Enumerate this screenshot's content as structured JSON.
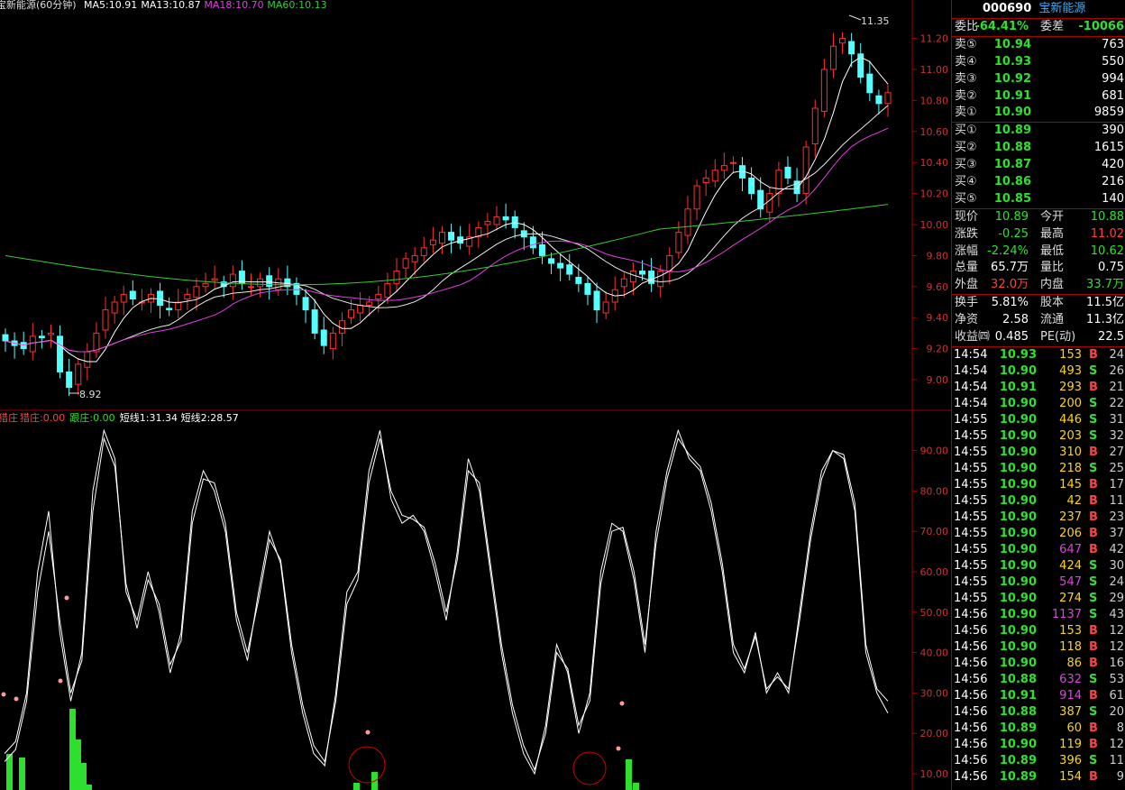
{
  "main_chart": {
    "title": "宝新能源(60分钟)",
    "ma": [
      {
        "label": "MA5:10.91",
        "color": "#ffffff"
      },
      {
        "label": "MA13:10.87",
        "color": "#ffffff"
      },
      {
        "label": "MA18:10.70",
        "color": "#e040e0"
      },
      {
        "label": "MA60:10.13",
        "color": "#33cc33"
      }
    ],
    "y_ticks": [
      "11.20",
      "11.00",
      "10.80",
      "10.60",
      "10.40",
      "10.20",
      "10.00",
      "9.80",
      "9.60",
      "9.40",
      "9.20",
      "9.00"
    ],
    "high_label": "11.35",
    "low_label": "8.92"
  },
  "sub_chart": {
    "title": "猎庄",
    "items": [
      {
        "label": "猎庄:0.00",
        "color": "#ff4040"
      },
      {
        "label": "跟庄:0.00",
        "color": "#2ee02e"
      },
      {
        "label": "短线1:31.34",
        "color": "#ffffff"
      },
      {
        "label": "短线2:28.57",
        "color": "#ffffff"
      }
    ],
    "y_ticks": [
      "90.00",
      "80.00",
      "70.00",
      "60.00",
      "50.00",
      "40.00",
      "30.00",
      "20.00",
      "10.00"
    ]
  },
  "chart_data": {
    "type": "line",
    "price_series": {
      "name": "宝新能源",
      "y_range": [
        8.9,
        11.4
      ],
      "closes": [
        9.25,
        9.22,
        9.2,
        9.28,
        9.27,
        9.3,
        9.05,
        8.95,
        9.1,
        9.18,
        9.3,
        9.45,
        9.5,
        9.55,
        9.52,
        9.5,
        9.55,
        9.48,
        9.45,
        9.5,
        9.55,
        9.6,
        9.62,
        9.65,
        9.6,
        9.68,
        9.62,
        9.6,
        9.65,
        9.6,
        9.65,
        9.6,
        9.55,
        9.45,
        9.3,
        9.22,
        9.3,
        9.38,
        9.45,
        9.48,
        9.5,
        9.55,
        9.62,
        9.7,
        9.78,
        9.8,
        9.85,
        9.9,
        9.95,
        9.9,
        9.88,
        9.92,
        9.98,
        10.02,
        10.05,
        10.03,
        9.98,
        9.92,
        9.85,
        9.8,
        9.75,
        9.72,
        9.68,
        9.62,
        9.55,
        9.45,
        9.5,
        9.58,
        9.65,
        9.7,
        9.68,
        9.62,
        9.7,
        9.8,
        9.95,
        10.1,
        10.25,
        10.3,
        10.35,
        10.38,
        10.4,
        10.3,
        10.2,
        10.1,
        10.2,
        10.35,
        10.3,
        10.2,
        10.5,
        10.75,
        11.0,
        11.15,
        11.2,
        11.1,
        10.95,
        10.85,
        10.78,
        10.85
      ],
      "ma60_start": 9.8,
      "ma60_end": 10.13
    },
    "indicator_series": [
      {
        "name": "短线1",
        "values": [
          15,
          18,
          30,
          60,
          75,
          45,
          28,
          40,
          80,
          95,
          88,
          55,
          48,
          60,
          50,
          35,
          45,
          75,
          85,
          80,
          70,
          48,
          38,
          55,
          70,
          62,
          40,
          25,
          15,
          12,
          30,
          55,
          60,
          85,
          95,
          78,
          72,
          74,
          70,
          60,
          48,
          65,
          88,
          80,
          60,
          40,
          25,
          15,
          10,
          22,
          42,
          35,
          20,
          30,
          60,
          72,
          70,
          58,
          40,
          70,
          85,
          95,
          88,
          85,
          75,
          60,
          40,
          35,
          45,
          30,
          35,
          30,
          50,
          70,
          85,
          90,
          88,
          75,
          40,
          30,
          25
        ]
      },
      {
        "name": "短线2",
        "values": [
          13,
          16,
          28,
          55,
          70,
          48,
          30,
          38,
          75,
          93,
          86,
          57,
          46,
          58,
          52,
          37,
          43,
          72,
          83,
          82,
          72,
          50,
          40,
          53,
          68,
          63,
          42,
          27,
          17,
          13,
          28,
          52,
          58,
          82,
          93,
          80,
          74,
          73,
          71,
          62,
          50,
          63,
          85,
          82,
          62,
          42,
          27,
          17,
          11,
          20,
          40,
          36,
          22,
          28,
          57,
          70,
          71,
          60,
          42,
          67,
          83,
          93,
          89,
          86,
          77,
          62,
          42,
          36,
          44,
          31,
          34,
          31,
          48,
          68,
          83,
          90,
          89,
          77,
          42,
          31,
          28
        ]
      }
    ],
    "bar_series": {
      "name": "跟庄",
      "color": "#2ee02e"
    }
  },
  "panel": {
    "code": "000690",
    "name": "宝新能源",
    "weibi": {
      "label": "委比",
      "value": "-64.41%",
      "label2": "委差",
      "value2": "-10066"
    },
    "sells": [
      {
        "label": "卖⑤",
        "price": "10.94",
        "vol": "763"
      },
      {
        "label": "卖④",
        "price": "10.93",
        "vol": "550"
      },
      {
        "label": "卖③",
        "price": "10.92",
        "vol": "994"
      },
      {
        "label": "卖②",
        "price": "10.91",
        "vol": "681"
      },
      {
        "label": "卖①",
        "price": "10.90",
        "vol": "9859"
      }
    ],
    "buys": [
      {
        "label": "买①",
        "price": "10.89",
        "vol": "390"
      },
      {
        "label": "买②",
        "price": "10.88",
        "vol": "1615"
      },
      {
        "label": "买③",
        "price": "10.87",
        "vol": "420"
      },
      {
        "label": "买④",
        "price": "10.86",
        "vol": "216"
      },
      {
        "label": "买⑤",
        "price": "10.85",
        "vol": "140"
      }
    ],
    "stats1": [
      {
        "l1": "现价",
        "v1": "10.89",
        "c1": "green",
        "l2": "今开",
        "v2": "10.88",
        "c2": "green"
      },
      {
        "l1": "涨跌",
        "v1": "-0.25",
        "c1": "green",
        "l2": "最高",
        "v2": "11.02",
        "c2": "red"
      },
      {
        "l1": "涨幅",
        "v1": "-2.24%",
        "c1": "green",
        "l2": "最低",
        "v2": "10.62",
        "c2": "green"
      },
      {
        "l1": "总量",
        "v1": "65.7万",
        "c1": "white",
        "l2": "量比",
        "v2": "0.75",
        "c2": "white"
      },
      {
        "l1": "外盘",
        "v1": "32.0万",
        "c1": "red",
        "l2": "内盘",
        "v2": "33.7万",
        "c2": "green"
      }
    ],
    "stats2": [
      {
        "l1": "换手",
        "v1": "5.81%",
        "l2": "股本",
        "v2": "11.5亿"
      },
      {
        "l1": "净资",
        "v1": "2.58",
        "l2": "流通",
        "v2": "11.3亿"
      },
      {
        "l1": "收益㈣",
        "v1": "0.485",
        "l2": "PE(动)",
        "v2": "22.5"
      }
    ],
    "ticks": [
      {
        "t": "14:54",
        "p": "10.93",
        "pc": "green",
        "v": "153",
        "vc": "yellow",
        "s": "B",
        "sc": "red",
        "n": "24"
      },
      {
        "t": "14:54",
        "p": "10.90",
        "pc": "green",
        "v": "493",
        "vc": "yellow",
        "s": "S",
        "sc": "green",
        "n": "26"
      },
      {
        "t": "14:54",
        "p": "10.91",
        "pc": "green",
        "v": "293",
        "vc": "yellow",
        "s": "B",
        "sc": "red",
        "n": "21"
      },
      {
        "t": "14:54",
        "p": "10.90",
        "pc": "green",
        "v": "200",
        "vc": "yellow",
        "s": "S",
        "sc": "green",
        "n": "22"
      },
      {
        "t": "14:55",
        "p": "10.90",
        "pc": "green",
        "v": "446",
        "vc": "yellow",
        "s": "S",
        "sc": "green",
        "n": "31"
      },
      {
        "t": "14:55",
        "p": "10.90",
        "pc": "green",
        "v": "203",
        "vc": "yellow",
        "s": "S",
        "sc": "green",
        "n": "32"
      },
      {
        "t": "14:55",
        "p": "10.90",
        "pc": "green",
        "v": "310",
        "vc": "yellow",
        "s": "B",
        "sc": "red",
        "n": "27"
      },
      {
        "t": "14:55",
        "p": "10.90",
        "pc": "green",
        "v": "218",
        "vc": "yellow",
        "s": "S",
        "sc": "green",
        "n": "25"
      },
      {
        "t": "14:55",
        "p": "10.90",
        "pc": "green",
        "v": "145",
        "vc": "yellow",
        "s": "B",
        "sc": "red",
        "n": "17"
      },
      {
        "t": "14:55",
        "p": "10.90",
        "pc": "green",
        "v": "42",
        "vc": "yellow",
        "s": "B",
        "sc": "red",
        "n": "11"
      },
      {
        "t": "14:55",
        "p": "10.90",
        "pc": "green",
        "v": "237",
        "vc": "yellow",
        "s": "B",
        "sc": "red",
        "n": "23"
      },
      {
        "t": "14:55",
        "p": "10.90",
        "pc": "green",
        "v": "206",
        "vc": "yellow",
        "s": "B",
        "sc": "red",
        "n": "37"
      },
      {
        "t": "14:55",
        "p": "10.90",
        "pc": "green",
        "v": "647",
        "vc": "magenta",
        "s": "B",
        "sc": "red",
        "n": "42"
      },
      {
        "t": "14:55",
        "p": "10.90",
        "pc": "green",
        "v": "424",
        "vc": "yellow",
        "s": "S",
        "sc": "green",
        "n": "30"
      },
      {
        "t": "14:55",
        "p": "10.90",
        "pc": "green",
        "v": "547",
        "vc": "magenta",
        "s": "S",
        "sc": "green",
        "n": "24"
      },
      {
        "t": "14:55",
        "p": "10.90",
        "pc": "green",
        "v": "274",
        "vc": "yellow",
        "s": "S",
        "sc": "green",
        "n": "29"
      },
      {
        "t": "14:56",
        "p": "10.90",
        "pc": "green",
        "v": "1137",
        "vc": "magenta",
        "s": "S",
        "sc": "green",
        "n": "43"
      },
      {
        "t": "14:56",
        "p": "10.90",
        "pc": "green",
        "v": "153",
        "vc": "yellow",
        "s": "B",
        "sc": "red",
        "n": "12"
      },
      {
        "t": "14:56",
        "p": "10.90",
        "pc": "green",
        "v": "118",
        "vc": "yellow",
        "s": "B",
        "sc": "red",
        "n": "12"
      },
      {
        "t": "14:56",
        "p": "10.90",
        "pc": "green",
        "v": "86",
        "vc": "yellow",
        "s": "B",
        "sc": "red",
        "n": "16"
      },
      {
        "t": "14:56",
        "p": "10.88",
        "pc": "green",
        "v": "632",
        "vc": "magenta",
        "s": "S",
        "sc": "green",
        "n": "53"
      },
      {
        "t": "14:56",
        "p": "10.91",
        "pc": "green",
        "v": "914",
        "vc": "magenta",
        "s": "B",
        "sc": "red",
        "n": "61"
      },
      {
        "t": "14:56",
        "p": "10.88",
        "pc": "green",
        "v": "387",
        "vc": "yellow",
        "s": "S",
        "sc": "green",
        "n": "20"
      },
      {
        "t": "14:56",
        "p": "10.89",
        "pc": "green",
        "v": "60",
        "vc": "yellow",
        "s": "B",
        "sc": "red",
        "n": "8"
      },
      {
        "t": "14:56",
        "p": "10.90",
        "pc": "green",
        "v": "119",
        "vc": "yellow",
        "s": "B",
        "sc": "red",
        "n": "12"
      },
      {
        "t": "14:56",
        "p": "10.89",
        "pc": "green",
        "v": "396",
        "vc": "yellow",
        "s": "S",
        "sc": "green",
        "n": "11"
      },
      {
        "t": "14:56",
        "p": "10.89",
        "pc": "green",
        "v": "154",
        "vc": "yellow",
        "s": "B",
        "sc": "red",
        "n": "9"
      }
    ]
  }
}
